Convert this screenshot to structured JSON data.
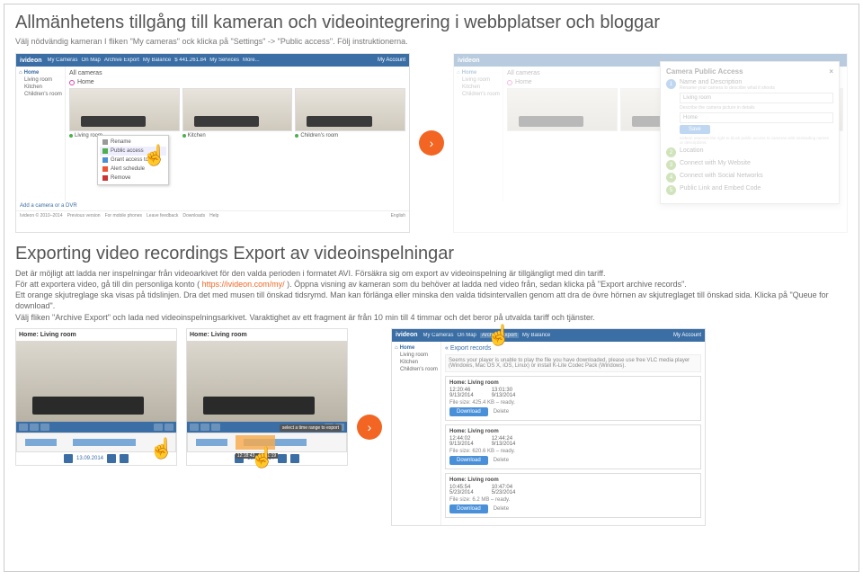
{
  "section1": {
    "title": "Allmänhetens tillgång till kameran och videointegrering i webbplatser och bloggar",
    "subtitle": "Välj nödvändig kameran I fliken \"My cameras\" ock klicka på \"Settings\" -> \"Public access\". Följ instruktionerna."
  },
  "app": {
    "brand": "ivideon",
    "nav": {
      "cameras": "My Cameras",
      "map": "On Map",
      "archive": "Archive Export",
      "balance": "My Balance",
      "balance_val": "$ 441.261.84",
      "services": "My Services",
      "more": "More..."
    },
    "account": "My Account",
    "addlink": "Add a camera or a DVR",
    "footer": {
      "copy": "Ivideon © 2010–2014",
      "prev": "Previous version",
      "mobile": "For mobile phones",
      "feedback": "Leave feedback",
      "downloads": "Downloads",
      "help": "Help",
      "lang": "English"
    }
  },
  "sidebar": {
    "home": "Home",
    "items": [
      "Living room",
      "Kitchen",
      "Children's room"
    ]
  },
  "cams": {
    "all": "All cameras",
    "home": "Home",
    "list": [
      "Living room",
      "Kitchen",
      "Children's room"
    ]
  },
  "ctxmenu": {
    "items": [
      "Rename",
      "Public access",
      "Grant access to ot...",
      "Alert schedule",
      "Remove"
    ]
  },
  "dialog": {
    "title": "Camera Public Access",
    "step1": {
      "label": "Name and Description",
      "rename": "Rename your camera to describe what it shoots",
      "name_val": "Living room",
      "desc_label": "Describe the camera picture in details",
      "desc_val": "Home",
      "save": "Save",
      "note": "Ivideon reserves the right to block public access to cameras with misleading names or descriptions."
    },
    "step2": "Location",
    "step3": "Connect with My Website",
    "step4": "Connect with Social Networks",
    "step5": "Public Link and Embed Code"
  },
  "section2": {
    "title": "Exporting video recordings Export av videoinspelningar",
    "p1": "Det är möjligt att ladda ner inspelningar från videoarkivet för den valda perioden i formatet AVI. Försäkra sig om export av videoinspelning är tillgängligt med din tariff.",
    "p2a": "För att exportera video, gå till din personliga konto ( ",
    "link": "https://ivideon.com/my/",
    "p2b": " ). Öppna visning av kameran som du behöver at ladda ned video från, sedan klicka på \"Export archive records\".",
    "p3": "Ett orange skjutreglage ska visas på tidslinjen. Dra det med musen till önskad tidsrymd. Man kan förlänga eller minska den valda tidsintervallen genom att dra de övre hörnen av skjutreglaget till önskad sida. Klicka på \"Queue for download\".",
    "p4": "Välj fliken \"Archive Export\" och lada ned videoinspelningsarkivet. Varaktighet av ett fragment är från 10 min till 4 timmar och det beror på utvalda tariff och tjänster."
  },
  "player": {
    "title": "Home: Living room",
    "timeline_label": "select a time range to export",
    "range_text": "12:18:43 - 13:01:19",
    "date": "13.09.2014"
  },
  "export": {
    "tab": "Export records",
    "note": "Seems your player is unable to play the file you have downloaded, please use free VLC media player (Windows, Mac OS X, iOS, Linux) or install K-Lite Codec Pack (Windows).",
    "cards": [
      {
        "title": "Home: Living room",
        "t1": "12:20:46",
        "d1": "9/13/2014",
        "t2": "13:01:30",
        "d2": "9/13/2014",
        "size": "File size: 425.4 KB – ready.",
        "dl": "Download",
        "del": "Delete"
      },
      {
        "title": "Home: Living room",
        "t1": "12:44:02",
        "d1": "9/13/2014",
        "t2": "12:44:24",
        "d2": "9/13/2014",
        "size": "File size: 620.6 KB – ready.",
        "dl": "Download",
        "del": "Delete"
      },
      {
        "title": "Home: Living room",
        "t1": "10:45:54",
        "d1": "5/23/2014",
        "t2": "10:47:04",
        "d2": "5/23/2014",
        "size": "File size: 6.2 MB – ready.",
        "dl": "Download",
        "del": "Delete"
      }
    ]
  }
}
